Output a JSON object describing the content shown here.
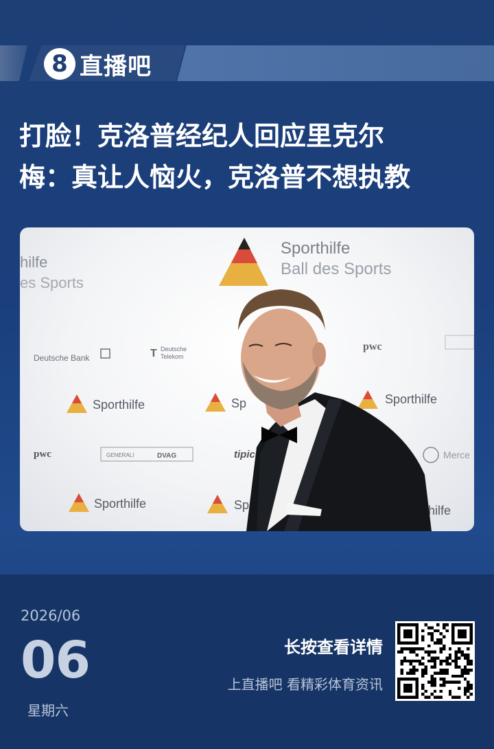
{
  "brand": {
    "name": "直播吧",
    "badge": "8",
    "icon": "logo-8-icon"
  },
  "headline": {
    "line1": "打脸！克洛普经纪人回应里克尔",
    "line2": "梅：真让人恼火，克洛普不想执教"
  },
  "photo": {
    "backdrop": {
      "sporthilfe": "Sporthilfe",
      "ball": "Ball des Sports",
      "deutsche_bank": "Deutsche Bank",
      "telekom_line1": "Deutsche",
      "telekom_line2": "Telekom",
      "pwc": "pwc",
      "generali": "GENERALI",
      "dvag": "DVAG",
      "tipico": "tipico",
      "mercedes": "Merce",
      "partial_hilfe": "hilfe",
      "partial_sports": "es Sports",
      "partial_sp": "Sp"
    }
  },
  "footer": {
    "year_month": "2026/06",
    "day": "06",
    "weekday": "星期六",
    "cta_main": "长按查看详情",
    "cta_sub": "上直播吧 看精彩体育资讯",
    "qr_icon": "qr-code-icon"
  },
  "colors": {
    "background": "#1d3f76",
    "footer": "#163566"
  }
}
